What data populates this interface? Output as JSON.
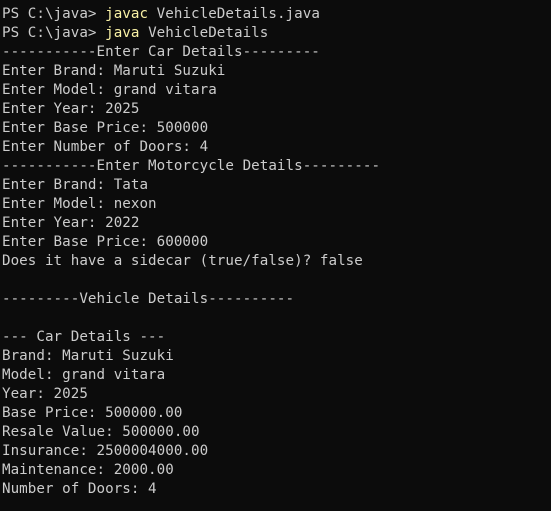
{
  "terminal": {
    "prompt1": "PS C:\\java> ",
    "cmd1": "javac",
    "args1": " VehicleDetails.java",
    "prompt2": "PS C:\\java> ",
    "cmd2": "java",
    "args2": " VehicleDetails",
    "output": [
      "-----------Enter Car Details---------",
      "Enter Brand: Maruti Suzuki",
      "Enter Model: grand vitara",
      "Enter Year: 2025",
      "Enter Base Price: 500000",
      "Enter Number of Doors: 4",
      "-----------Enter Motorcycle Details---------",
      "Enter Brand: Tata",
      "Enter Model: nexon",
      "Enter Year: 2022",
      "Enter Base Price: 600000",
      "Does it have a sidecar (true/false)? false",
      "",
      "---------Vehicle Details----------",
      "",
      "--- Car Details ---",
      "Brand: Maruti Suzuki",
      "Model: grand vitara",
      "Year: 2025",
      "Base Price: 500000.00",
      "Resale Value: 500000.00",
      "Insurance: 2500004000.00",
      "Maintenance: 2000.00",
      "Number of Doors: 4"
    ]
  }
}
